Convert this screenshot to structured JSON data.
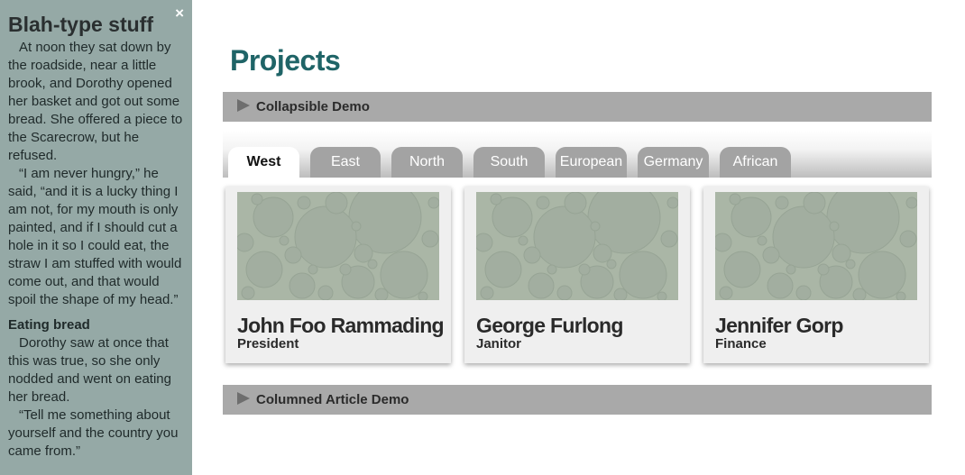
{
  "sidebar": {
    "close_label": "×",
    "title": "Blah-type stuff",
    "paragraph1": "At noon they sat down by the roadside, near a little brook, and Dorothy opened her basket and got out some bread. She offered a piece to the Scarecrow, but he refused.",
    "paragraph2": "“I am never hungry,” he said, “and it is a lucky thing I am not, for my mouth is only painted, and if I should cut a hole in it so I could eat, the straw I am stuffed with would come out, and that would spoil the shape of my head.”",
    "subheading": "Eating bread",
    "paragraph3": "Dorothy saw at once that this was true, so she only nodded and went on eating her bread.",
    "paragraph4": "“Tell me something about yourself and the country you came from.”"
  },
  "main": {
    "title": "Projects",
    "collapsible_demo_label": "Collapsible Demo",
    "columned_article_label": "Columned Article Demo",
    "tabs": [
      {
        "label": "West",
        "active": true
      },
      {
        "label": "East",
        "active": false
      },
      {
        "label": "North",
        "active": false
      },
      {
        "label": "South",
        "active": false
      },
      {
        "label": "European",
        "active": false
      },
      {
        "label": "Germany",
        "active": false
      },
      {
        "label": "African",
        "active": false
      }
    ],
    "cards": [
      {
        "name": "John Foo Rammading",
        "role": "President"
      },
      {
        "name": "George Furlong",
        "role": "Janitor"
      },
      {
        "name": "Jennifer Gorp",
        "role": "Finance"
      }
    ]
  },
  "colors": {
    "sidebar_bg": "#95a9a6",
    "title": "#1f6467",
    "bar_bg": "#a9a9a9",
    "tab_bg": "#a3a3a3",
    "card_bg": "#efefef",
    "pattern_bg": "#aab6a6",
    "pattern_circle": "#a2aea0"
  }
}
